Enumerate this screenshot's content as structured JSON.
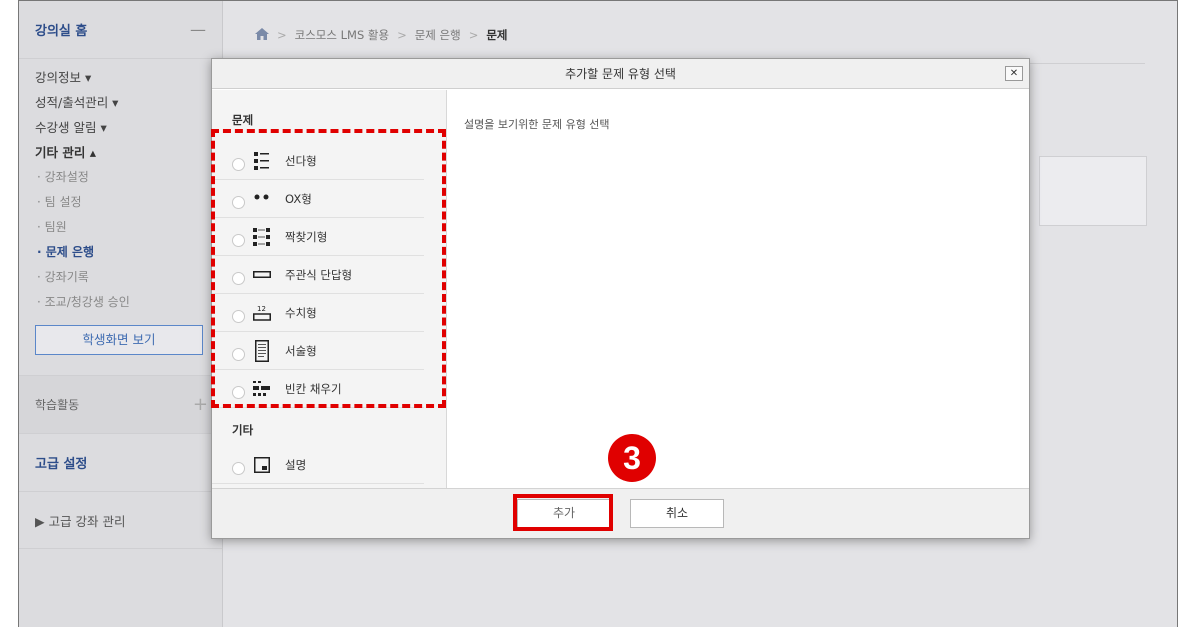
{
  "sidebar": {
    "home": "강의실 홈",
    "home_toggle": "—",
    "menu": [
      {
        "label": "강의정보 ▾"
      },
      {
        "label": "성적/출석관리 ▾"
      },
      {
        "label": "수강생 알림 ▾"
      },
      {
        "label": "기타 관리 ▴"
      }
    ],
    "sub": [
      {
        "label": "· 강좌설정"
      },
      {
        "label": "· 팀 설정"
      },
      {
        "label": "· 팀원"
      },
      {
        "label": "· 문제 은행"
      },
      {
        "label": "· 강좌기록"
      },
      {
        "label": "· 조교/청강생 승인"
      }
    ],
    "student_view_btn": "학생화면 보기",
    "learning": "학습활동",
    "learning_plus": "+",
    "advanced": "고급 설정",
    "advanced_course": "▶  고급 강좌 관리"
  },
  "breadcrumb": {
    "home_icon": "home-icon",
    "sep": ">",
    "items": [
      "코스모스 LMS 활용",
      "문제 은행",
      "문제"
    ]
  },
  "modal": {
    "title": "추가할 문제 유형 선택",
    "close": "✕",
    "category1": "문제",
    "question_types": [
      {
        "label": "선다형",
        "icon": "multichoice-icon"
      },
      {
        "label": "OX형",
        "icon": "truefalse-icon"
      },
      {
        "label": "짝찾기형",
        "icon": "matching-icon"
      },
      {
        "label": "주관식 단답형",
        "icon": "shortanswer-icon"
      },
      {
        "label": "수치형",
        "icon": "numerical-icon"
      },
      {
        "label": "서술형",
        "icon": "essay-icon"
      },
      {
        "label": "빈칸 채우기",
        "icon": "cloze-icon"
      }
    ],
    "category2": "기타",
    "other_types": [
      {
        "label": "설명",
        "icon": "description-icon"
      }
    ],
    "description": "설명을 보기위한 문제 유형 선택",
    "add_button": "추가",
    "cancel_button": "취소"
  },
  "annotation": {
    "step": "3",
    "color": "#e00000"
  }
}
